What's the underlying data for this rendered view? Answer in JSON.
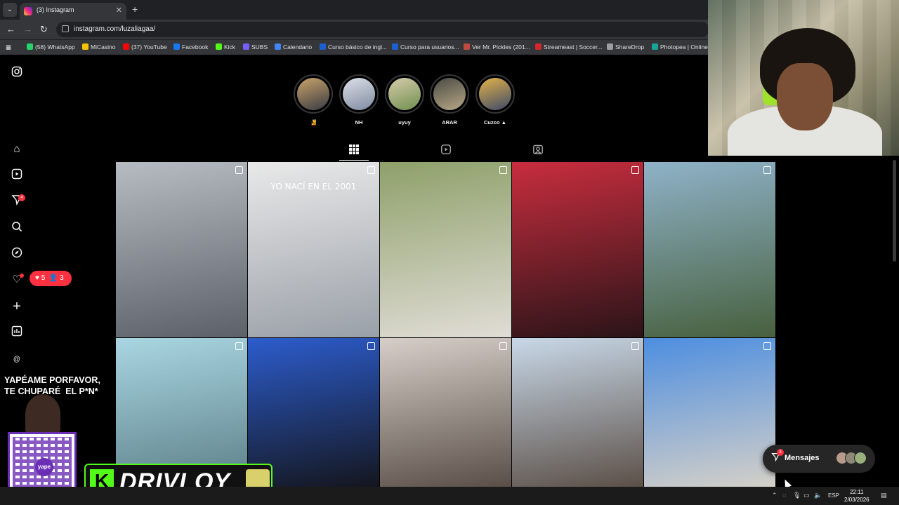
{
  "browser": {
    "tab_title": "(3) Instagram",
    "new_tab": "+",
    "url": "instagram.com/luzaliagaa/",
    "bookmarks": [
      {
        "label": "(58) WhatsApp",
        "color": "#25d366"
      },
      {
        "label": "MiCasino",
        "color": "#f5c400"
      },
      {
        "label": "(37) YouTube",
        "color": "#ff0000"
      },
      {
        "label": "Facebook",
        "color": "#1877f2"
      },
      {
        "label": "Kick",
        "color": "#53fc18"
      },
      {
        "label": "SUBS",
        "color": "#7a5cff"
      },
      {
        "label": "Calendario",
        "color": "#4285f4"
      },
      {
        "label": "Curso básico de ingl...",
        "color": "#1c5fd1"
      },
      {
        "label": "Curso para usuarios...",
        "color": "#1c5fd1"
      },
      {
        "label": "Ver Mr. Pickles (201...",
        "color": "#c24a3c"
      },
      {
        "label": "Streameast | Soccer...",
        "color": "#d3262e"
      },
      {
        "label": "ShareDrop",
        "color": "#9e9e9e"
      },
      {
        "label": "Photopea | Online",
        "color": "#18a497"
      }
    ]
  },
  "instagram": {
    "notifications_badge": "4",
    "activity": {
      "likes": "5",
      "followers": "3"
    },
    "highlights": [
      {
        "label": "🧏",
        "colors": [
          "#c9a46a",
          "#3a3a44"
        ]
      },
      {
        "label": "NH",
        "colors": [
          "#dde1e8",
          "#7f8aa0"
        ]
      },
      {
        "label": "uyuy",
        "colors": [
          "#d6ccaa",
          "#6f8f50"
        ]
      },
      {
        "label": "ARAR",
        "colors": [
          "#4a4a42",
          "#b8a888"
        ]
      },
      {
        "label": "Cuzco ▲",
        "colors": [
          "#e4b248",
          "#3d4a6a"
        ]
      }
    ],
    "posts": [
      {
        "colors": [
          "#b7bcc2",
          "#5c6068"
        ],
        "type": "reel",
        "caption": ""
      },
      {
        "colors": [
          "#e9e9e9",
          "#9aa0a8"
        ],
        "type": "reel",
        "caption": "YO NACÍ EN EL 2001"
      },
      {
        "colors": [
          "#8fa06a",
          "#e0ddd6"
        ],
        "type": "carousel",
        "caption": ""
      },
      {
        "colors": [
          "#c82d3e",
          "#2a1418"
        ],
        "type": "carousel",
        "caption": ""
      },
      {
        "colors": [
          "#8fb2c8",
          "#47603e"
        ],
        "type": "carousel",
        "caption": ""
      },
      {
        "colors": [
          "#a9d6e2",
          "#5c7f88"
        ],
        "type": "carousel",
        "caption": ""
      },
      {
        "colors": [
          "#2c5ccc",
          "#14161e"
        ],
        "type": "carousel",
        "caption": ""
      },
      {
        "colors": [
          "#d6cfc8",
          "#5a4e48"
        ],
        "type": "carousel",
        "caption": ""
      },
      {
        "colors": [
          "#c8d8e8",
          "#5c5048"
        ],
        "type": "carousel",
        "caption": ""
      },
      {
        "colors": [
          "#4d8ee0",
          "#d4d0c8"
        ],
        "type": "carousel",
        "caption": ""
      }
    ],
    "messages": {
      "label": "Mensajes",
      "badge": "3"
    }
  },
  "overlay": {
    "promo_text": "YAPÉAME PORFAVOR,\nTE CHUPARÉ  EL P*N*",
    "qr_label": "yape",
    "streamer_name": "DRIVLOY"
  },
  "taskbar": {
    "lang": "ESP",
    "time": "22:11",
    "date": "2/03/2026"
  }
}
